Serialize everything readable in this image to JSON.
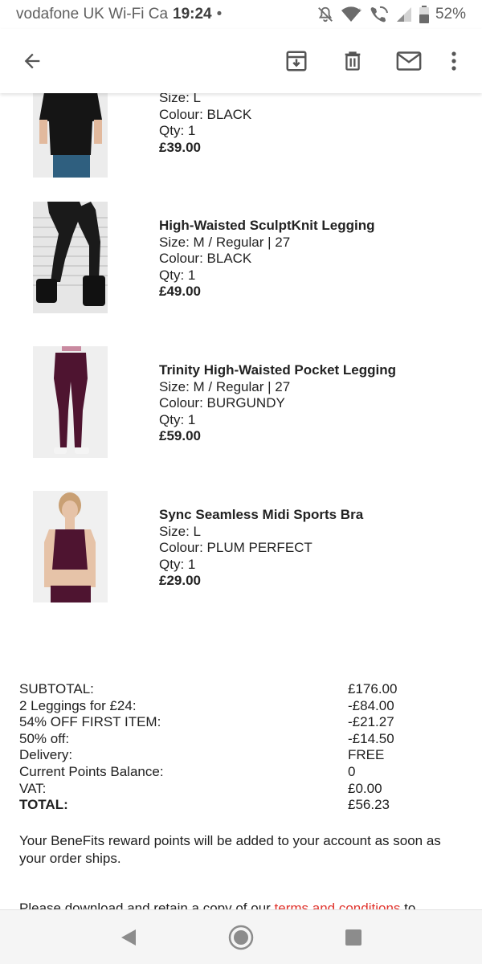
{
  "status_bar": {
    "carrier": "vodafone UK Wi-Fi Ca",
    "time": "19:24",
    "dot": "•",
    "battery": "52%"
  },
  "app_bar": {
    "icons": [
      "arrow-back-icon",
      "archive-icon",
      "delete-icon",
      "mail-icon",
      "more-vert-icon"
    ]
  },
  "products": [
    {
      "name": "",
      "size": "Size: L",
      "colour": "Colour: BLACK",
      "qty": "Qty: 1",
      "price": "£39.00"
    },
    {
      "name": "High-Waisted SculptKnit Legging",
      "size": "Size: M / Regular | 27",
      "colour": "Colour: BLACK",
      "qty": "Qty: 1",
      "price": "£49.00"
    },
    {
      "name": "Trinity High-Waisted Pocket Legging",
      "size": "Size: M / Regular | 27",
      "colour": "Colour: BURGUNDY",
      "qty": "Qty: 1",
      "price": "£59.00"
    },
    {
      "name": "Sync Seamless Midi Sports Bra",
      "size": "Size: L",
      "colour": "Colour: PLUM PERFECT",
      "qty": "Qty: 1",
      "price": "£29.00"
    }
  ],
  "totals": [
    {
      "label": "SUBTOTAL:",
      "value": "£176.00"
    },
    {
      "label": "2 Leggings for £24:",
      "value": "-£84.00"
    },
    {
      "label": "54% OFF FIRST ITEM:",
      "value": "-£21.27"
    },
    {
      "label": "50% off:",
      "value": "-£14.50"
    },
    {
      "label": "Delivery:",
      "value": "FREE"
    },
    {
      "label": "Current Points Balance:",
      "value": "0"
    },
    {
      "label": "VAT:",
      "value": "£0.00"
    },
    {
      "label": "TOTAL:",
      "value": "£56.23"
    }
  ],
  "points_note": "Your BeneFits reward points will be added to your account as soon as your order ships.",
  "download_note": {
    "prefix": "Please download and retain a copy of our ",
    "link": "terms and conditions",
    "suffix": " to"
  },
  "colors": {
    "link": "#e0332c",
    "text": "#222222",
    "status_text": "#5f5f5f",
    "nav_bg": "#f5f5f5"
  }
}
